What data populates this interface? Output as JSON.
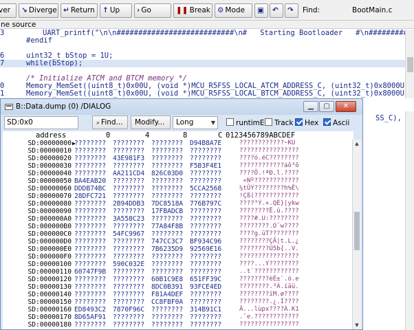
{
  "toolbar": {
    "over": "ver",
    "diverge": "Diverge",
    "return": "Return",
    "up": "Up",
    "go": "Go",
    "break": "Break",
    "mode": "Mode",
    "find_label": "Find:",
    "filename": "BootMain.c"
  },
  "source": {
    "header": "ne source",
    "lines": [
      {
        "num": "3",
        "code": "UART_printf(\"\\n\\n###########################\\n#   Starting Bootloader   #\\n#########"
      },
      {
        "num": "",
        "code": "#endif"
      },
      {
        "num": "6",
        "code": "uint32_t bStop = 1U;"
      },
      {
        "num": "7",
        "code": "while(bStop);"
      },
      {
        "num": "",
        "code": "/* Initialize ATCM and BTCM memory */"
      },
      {
        "num": "0",
        "code": "Memory_MemSet((uint8_t)0x00U, (void *)MCU_R5FSS_LOCAL_ATCM_ADDRESS_C, (uint32_t)0x8000U);"
      },
      {
        "num": "1",
        "code": "Memory_MemSet((uint8_t)0x00U, (void *)MCU_R5FSS_LOCAL_BTCM_ADDRESS_C, (uint32_t)0x8000U);"
      }
    ]
  },
  "background": {
    "fragment": "SS_C), lRe"
  },
  "dialog": {
    "title": "B::Data.dump (0) /DIALOG",
    "address": "SD:0x0",
    "find_label": "Find...",
    "modify_label": "Modify...",
    "width_value": "Long",
    "checks": [
      "runtimE",
      "Track",
      "Hex",
      "Ascii"
    ],
    "columns": [
      "address",
      "0",
      "4",
      "8",
      "C",
      "0123456789ABCDEF"
    ],
    "rows": [
      {
        "addr": "SD:00000000",
        "w": [
          "????????",
          "????????",
          "????????",
          "D94B8A7E"
        ],
        "ascii": "????????????~KÚ"
      },
      {
        "addr": "SD:00000010",
        "w": [
          "????????",
          "????????",
          "????????",
          "????????"
        ],
        "ascii": "????????????????"
      },
      {
        "addr": "SD:00000020",
        "w": [
          "????????",
          "43E981F3",
          "????????",
          "????????"
        ],
        "ascii": "????ó.éC????????"
      },
      {
        "addr": "SD:00000030",
        "w": [
          "????????",
          "????????",
          "????????",
          "F5B3F4E1"
        ],
        "ascii": "????????????áô³õ"
      },
      {
        "addr": "SD:00000040",
        "w": [
          "????????",
          "AA211CD4",
          "826C03D0",
          "????????"
        ],
        "ascii": "????Ô.!ªÐ.l.????"
      },
      {
        "addr": "SD:00000050",
        "w": [
          "BA4EAB20",
          "????????",
          "????????",
          "????????"
        ],
        "ascii": " «Nº????????????"
      },
      {
        "addr": "SD:00000060",
        "w": [
          "DDDB74BC",
          "????????",
          "????????",
          "5CCA2568"
        ],
        "ascii": "¼tÛÝ????????h%Ê\\"
      },
      {
        "addr": "SD:00000070",
        "w": [
          "28DFC721",
          "????????",
          "????????",
          "????????"
        ],
        "ascii": "!Çß(????????????"
      },
      {
        "addr": "SD:00000080",
        "w": [
          "????????",
          "2B94DDB3",
          "7DC8518A",
          "776B797C"
        ],
        "ascii": "????³Ý.+.QÈ}|ykw"
      },
      {
        "addr": "SD:00000090",
        "w": [
          "????????",
          "????????",
          "17FBADCB",
          "????????"
        ],
        "ascii": "????????Ë.û.????"
      },
      {
        "addr": "SD:000000A0",
        "w": [
          "????????",
          "3A558C23",
          "????????",
          "????????"
        ],
        "ascii": "????#.U:????????"
      },
      {
        "addr": "SD:000000B0",
        "w": [
          "????????",
          "????????",
          "77A84F8B",
          "????????"
        ],
        "ascii": "????????.O¨w????"
      },
      {
        "addr": "SD:000000C0",
        "w": [
          "????????",
          "54FC9967",
          "????????",
          "????????"
        ],
        "ascii": "????g.üT????????"
      },
      {
        "addr": "SD:000000D0",
        "w": [
          "????????",
          "????????",
          "747CC3C7",
          "BF934C96"
        ],
        "ascii": "????????ÇÃ|t.L.¿"
      },
      {
        "addr": "SD:000000E0",
        "w": [
          "????????",
          "????????",
          "7B6235D9",
          "92569E16"
        ],
        "ascii": "????????Ù5b{..V."
      },
      {
        "addr": "SD:000000F0",
        "w": [
          "????????",
          "????????",
          "????????",
          "????????"
        ],
        "ascii": "????????????????"
      },
      {
        "addr": "SD:00000100",
        "w": [
          "????????",
          "590C032E",
          "????????",
          "????????"
        ],
        "ascii": "????...Y????????"
      },
      {
        "addr": "SD:00000110",
        "w": [
          "60747F9B",
          "????????",
          "????????",
          "????????"
        ],
        "ascii": "..t`????????????"
      },
      {
        "addr": "SD:00000120",
        "w": [
          "????????",
          "????????",
          "60B1C9E8",
          "651FF39C"
        ],
        "ascii": "????????èÉ±`.ó.e"
      },
      {
        "addr": "SD:00000130",
        "w": [
          "????????",
          "????????",
          "8DC0B391",
          "93FCE4ED"
        ],
        "ascii": "????????.³À.íäü."
      },
      {
        "addr": "SD:00000140",
        "w": [
          "????????",
          "????????",
          "F81A4DEF",
          "????????"
        ],
        "ascii": "????????ïM.ø????"
      },
      {
        "addr": "SD:00000150",
        "w": [
          "????????",
          "????????",
          "CC8FBF0A",
          "????????"
        ],
        "ascii": "????????.¿.Ì????"
      },
      {
        "addr": "SD:00000160",
        "w": [
          "ED8493C2",
          "7870F96C",
          "????????",
          "314B91C1"
        ],
        "ascii": "Â...lùpx????Á.K1"
      },
      {
        "addr": "SD:00000170",
        "w": [
          "8D65AF91",
          "????????",
          "????????",
          "????????"
        ],
        "ascii": ".¯e.????????????"
      },
      {
        "addr": "SD:00000180",
        "w": [
          "????????",
          "????????",
          "????????",
          "????????"
        ],
        "ascii": "????????????????"
      }
    ]
  }
}
